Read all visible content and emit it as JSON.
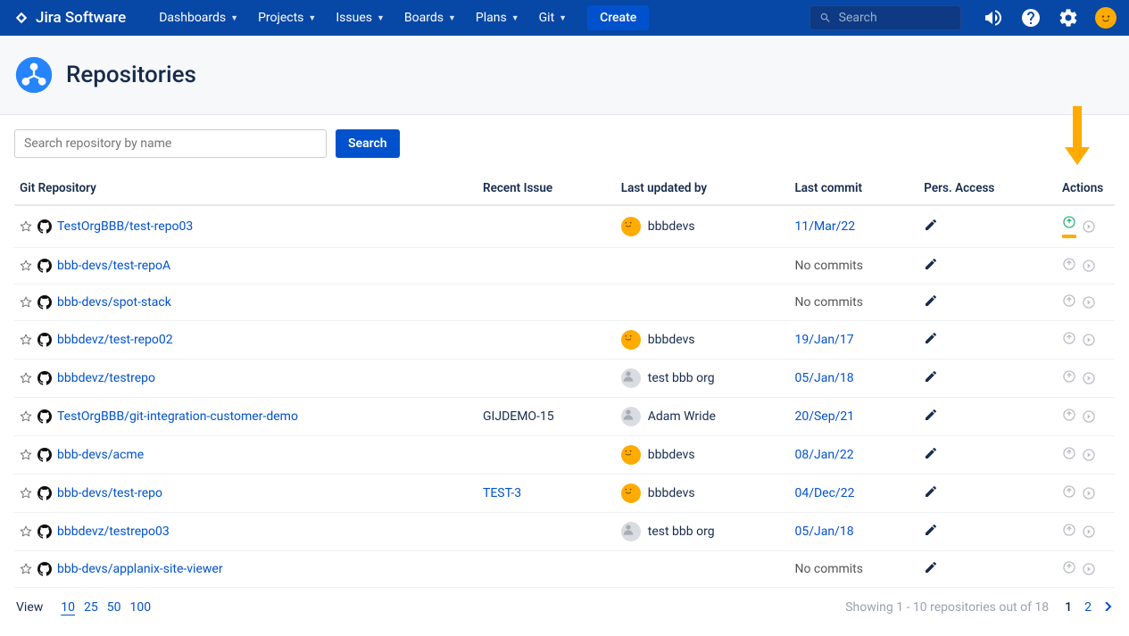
{
  "brand": "Jira Software",
  "nav": {
    "items": [
      "Dashboards",
      "Projects",
      "Issues",
      "Boards",
      "Plans",
      "Git"
    ],
    "create": "Create",
    "search_placeholder": "Search"
  },
  "page": {
    "title": "Repositories"
  },
  "toolbar": {
    "search_placeholder": "Search repository by name",
    "search_button": "Search"
  },
  "columns": {
    "repo": "Git Repository",
    "issue": "Recent Issue",
    "updated": "Last updated by",
    "commit": "Last commit",
    "access": "Pers. Access",
    "actions": "Actions"
  },
  "rows": [
    {
      "repo": "TestOrgBBB/test-repo03",
      "issue": "",
      "updated_name": "bbbdevs",
      "updated_avatar": "orange",
      "commit": "11/Mar/22",
      "action_highlight": true
    },
    {
      "repo": "bbb-devs/test-repoA",
      "issue": "",
      "updated_name": "",
      "updated_avatar": "",
      "commit": "No commits",
      "action_highlight": false
    },
    {
      "repo": "bbb-devs/spot-stack",
      "issue": "",
      "updated_name": "",
      "updated_avatar": "",
      "commit": "No commits",
      "action_highlight": false
    },
    {
      "repo": "bbbdevz/test-repo02",
      "issue": "",
      "updated_name": "bbbdevs",
      "updated_avatar": "orange",
      "commit": "19/Jan/17",
      "action_highlight": false
    },
    {
      "repo": "bbbdevz/testrepo",
      "issue": "",
      "updated_name": "test bbb org",
      "updated_avatar": "gray",
      "commit": "05/Jan/18",
      "action_highlight": false
    },
    {
      "repo": "TestOrgBBB/git-integration-customer-demo",
      "issue": "GIJDEMO-15",
      "updated_name": "Adam Wride",
      "updated_avatar": "gray",
      "commit": "20/Sep/21",
      "action_highlight": false,
      "issue_plain": true
    },
    {
      "repo": "bbb-devs/acme",
      "issue": "",
      "updated_name": "bbbdevs",
      "updated_avatar": "orange",
      "commit": "08/Jan/22",
      "action_highlight": false
    },
    {
      "repo": "bbb-devs/test-repo",
      "issue": "TEST-3",
      "updated_name": "bbbdevs",
      "updated_avatar": "orange",
      "commit": "04/Dec/22",
      "action_highlight": false
    },
    {
      "repo": "bbbdevz/testrepo03",
      "issue": "",
      "updated_name": "test bbb org",
      "updated_avatar": "gray",
      "commit": "05/Jan/18",
      "action_highlight": false
    },
    {
      "repo": "bbb-devs/applanix-site-viewer",
      "issue": "",
      "updated_name": "",
      "updated_avatar": "",
      "commit": "No commits",
      "action_highlight": false
    }
  ],
  "footer": {
    "view_label": "View",
    "page_sizes": [
      "10",
      "25",
      "50",
      "100"
    ],
    "active_size": "10",
    "showing": "Showing 1 - 10 repositories out of 18",
    "pages": [
      "1",
      "2"
    ],
    "current_page": "1"
  }
}
